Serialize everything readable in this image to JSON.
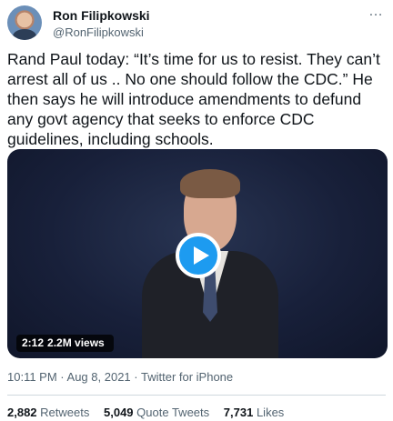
{
  "author": {
    "name": "Ron Filipkowski",
    "handle": "@RonFilipkowski"
  },
  "more_icon": "…",
  "tweet_text": "Rand Paul today: “It’s time for us to resist. They can’t arrest all of us .. No one should follow the CDC.” He then says he will introduce amendments to defund any govt agency that seeks to enforce CDC guidelines, including schools.",
  "video": {
    "duration": "2:12",
    "views": "2.2M views",
    "play_icon": "play-icon"
  },
  "meta": {
    "time": "10:11 PM",
    "separator": " · ",
    "date": "Aug 8, 2021",
    "source": "Twitter for iPhone"
  },
  "stats": {
    "retweets_count": "2,882",
    "retweets_label": "Retweets",
    "quotes_count": "5,049",
    "quotes_label": "Quote Tweets",
    "likes_count": "7,731",
    "likes_label": "Likes"
  },
  "colors": {
    "accent": "#1d9bf0",
    "text": "#0f1419",
    "secondary": "#536471"
  }
}
